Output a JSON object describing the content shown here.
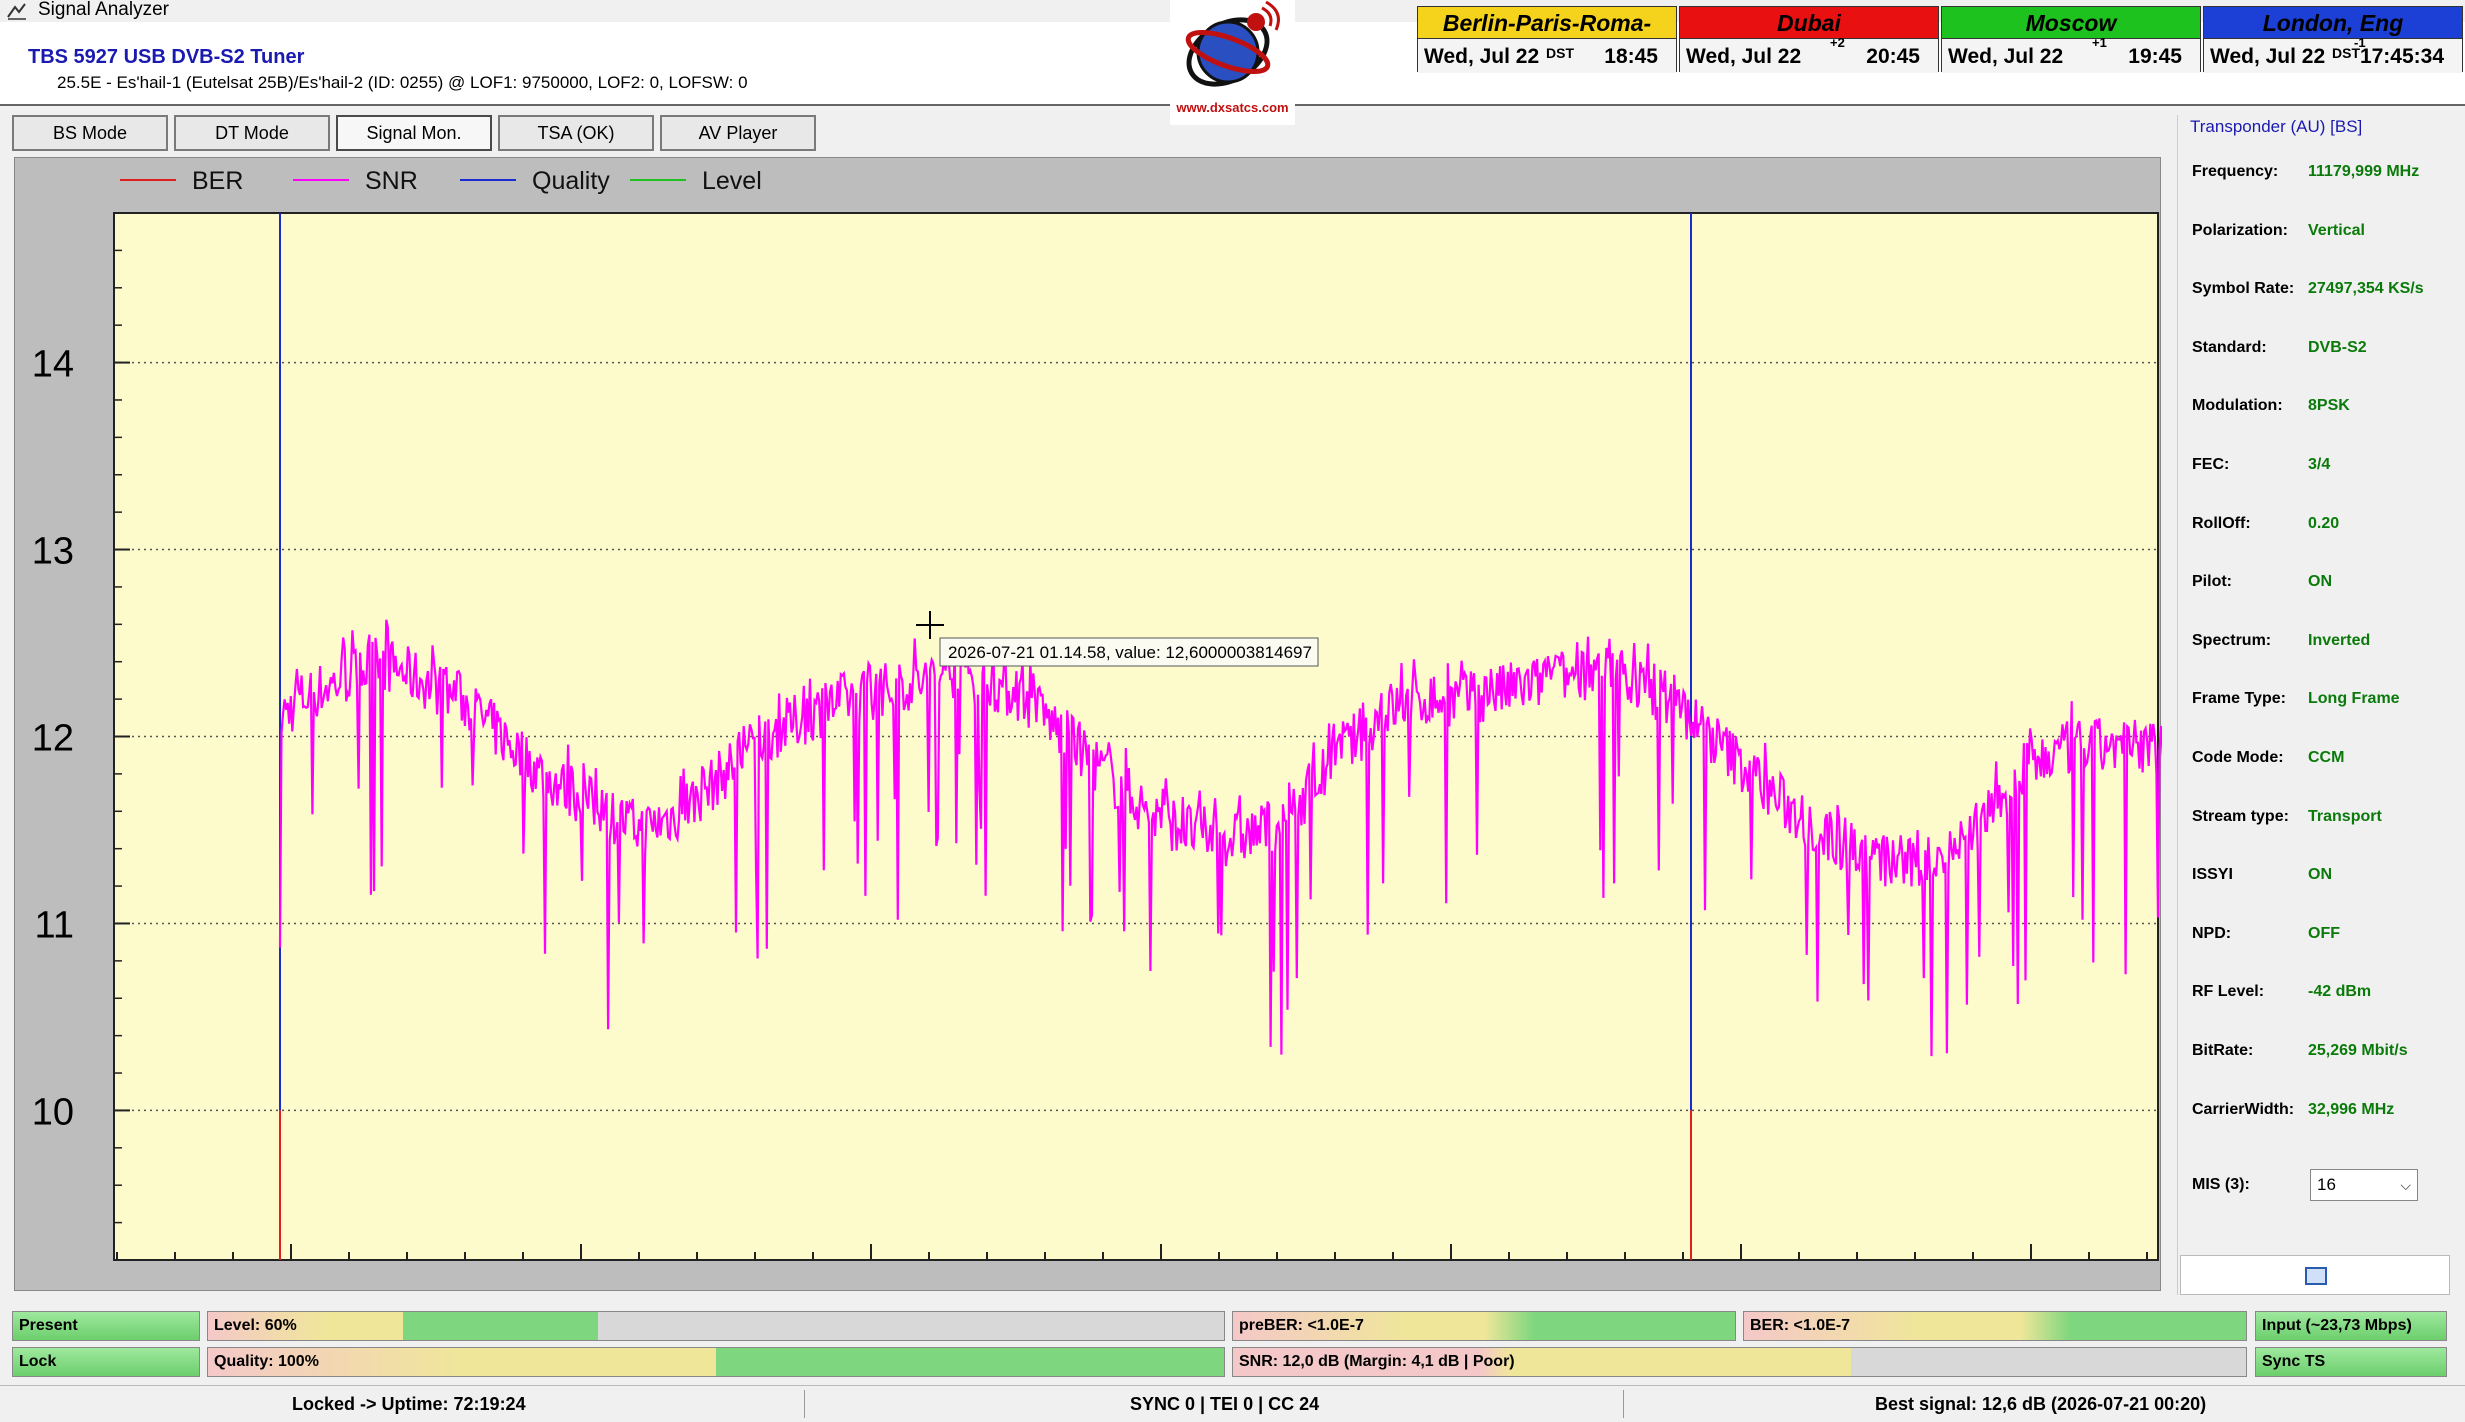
{
  "window": {
    "title": "Signal Analyzer"
  },
  "header": {
    "tuner_name": "TBS 5927 USB DVB-S2 Tuner",
    "tuner_info": "25.5E - Es'hail-1 (Eutelsat 25B)/Es'hail-2 (ID: 0255) @ LOF1: 9750000, LOF2: 0, LOFSW: 0",
    "logo_url": "www.dxsatcs.com"
  },
  "clocks": [
    {
      "city": "Berlin-Paris-Roma-Lučenec",
      "date": "Wed, Jul 22",
      "tz": "DST",
      "offset": "",
      "time": "18:45",
      "color": "#f5d31c",
      "text_color": "#000000"
    },
    {
      "city": "Dubai",
      "date": "Wed, Jul 22",
      "tz": "",
      "offset": "+2",
      "time": "20:45",
      "color": "#e81010",
      "text_color": "#000000"
    },
    {
      "city": "Moscow",
      "date": "Wed, Jul 22",
      "tz": "",
      "offset": "+1",
      "time": "19:45",
      "color": "#1ec21e",
      "text_color": "#000000"
    },
    {
      "city": "London, Eng",
      "date": "Wed, Jul 22",
      "tz": "DST",
      "offset": "-1",
      "time": "17:45:34",
      "color": "#1c3fd6",
      "text_color": "#000000"
    }
  ],
  "tabs": [
    {
      "label": "BS Mode",
      "active": false
    },
    {
      "label": "DT Mode",
      "active": false
    },
    {
      "label": "Signal Mon.",
      "active": true
    },
    {
      "label": "TSA (OK)",
      "active": false
    },
    {
      "label": "AV Player",
      "active": false
    }
  ],
  "chart_data": {
    "type": "line",
    "legend": [
      {
        "name": "BER",
        "color": "#e02020"
      },
      {
        "name": "SNR",
        "color": "#ff00ff"
      },
      {
        "name": "Quality",
        "color": "#1a2ad0"
      },
      {
        "name": "Level",
        "color": "#20c020"
      }
    ],
    "ylim": [
      9.2,
      14.8
    ],
    "yticks": [
      10,
      11,
      12,
      13,
      14
    ],
    "grid": true,
    "plot_background": "#fdfbcc",
    "tooltip": "2026-07-21 01.14.58, value: 12,6000003814697",
    "snr_series": {
      "name": "SNR",
      "x": [
        0,
        0.01,
        0.03,
        0.05,
        0.07,
        0.09,
        0.11,
        0.13,
        0.145,
        0.16,
        0.18,
        0.2,
        0.22,
        0.24,
        0.26,
        0.28,
        0.3,
        0.32,
        0.335,
        0.35,
        0.37,
        0.39,
        0.41,
        0.43,
        0.45,
        0.47,
        0.49,
        0.51,
        0.53,
        0.55,
        0.57,
        0.59,
        0.61,
        0.63,
        0.65,
        0.67,
        0.69,
        0.71,
        0.73,
        0.75,
        0.77,
        0.79,
        0.81,
        0.83,
        0.85,
        0.87,
        0.89,
        0.91,
        0.93,
        0.95,
        0.97,
        0.99,
        1.0,
        1.01,
        1.03,
        1.05,
        1.07
      ],
      "y": [
        12.1,
        12.2,
        12.3,
        12.4,
        12.3,
        12.2,
        12.0,
        11.8,
        11.7,
        11.6,
        11.5,
        11.6,
        11.8,
        12.0,
        12.1,
        12.2,
        12.25,
        12.3,
        12.35,
        12.3,
        12.2,
        12.0,
        11.8,
        11.6,
        11.5,
        11.45,
        11.5,
        11.7,
        11.95,
        12.15,
        12.2,
        12.2,
        12.25,
        12.3,
        12.35,
        12.3,
        12.2,
        12.0,
        11.8,
        11.6,
        11.45,
        11.35,
        11.3,
        11.4,
        11.6,
        11.85,
        11.95,
        11.95,
        11.95,
        12.0,
        11.95,
        11.9,
        11.9,
        11.9,
        11.95,
        12.0,
        12.0
      ]
    },
    "markers": [
      {
        "name": "Quality",
        "x": 0.0
      },
      {
        "name": "Quality",
        "x": 0.7
      }
    ]
  },
  "transponder": {
    "title": "Transponder (AU) [BS]",
    "rows": [
      {
        "key": "Frequency:",
        "value": "11179,999 MHz"
      },
      {
        "key": "Polarization:",
        "value": "Vertical"
      },
      {
        "key": "Symbol Rate:",
        "value": "27497,354 KS/s"
      },
      {
        "key": "Standard:",
        "value": "DVB-S2"
      },
      {
        "key": "Modulation:",
        "value": "8PSK"
      },
      {
        "key": "FEC:",
        "value": "3/4"
      },
      {
        "key": "RollOff:",
        "value": "0.20"
      },
      {
        "key": "Pilot:",
        "value": "ON"
      },
      {
        "key": "Spectrum:",
        "value": "Inverted"
      },
      {
        "key": "Frame Type:",
        "value": "Long Frame"
      },
      {
        "key": "Code Mode:",
        "value": "CCM"
      },
      {
        "key": "Stream type:",
        "value": "Transport"
      },
      {
        "key": "ISSYI",
        "value": "ON"
      },
      {
        "key": "NPD:",
        "value": "OFF"
      },
      {
        "key": "RF Level:",
        "value": "-42 dBm"
      },
      {
        "key": "BitRate:",
        "value": "25,269 Mbit/s"
      },
      {
        "key": "CarrierWidth:",
        "value": "32,996 MHz"
      }
    ],
    "mis_label": "MIS (3):",
    "mis_value": "16"
  },
  "status": {
    "present": "Present",
    "lock": "Lock",
    "level": "Level: 60%",
    "level_pct": 0.6,
    "quality": "Quality: 100%",
    "quality_pct": 1.0,
    "preber": "preBER: <1.0E-7",
    "snr": "SNR: 12,0 dB (Margin: 4,1 dB | Poor)",
    "ber": "BER: <1.0E-7",
    "input": "Input (~23,73 Mbps)",
    "sync_ts": "Sync TS"
  },
  "footer": {
    "uptime": "Locked -> Uptime: 72:19:24",
    "sync": "SYNC 0 | TEI 0 | CC 24",
    "best": "Best signal: 12,6 dB (2026-07-21 00:20)"
  }
}
